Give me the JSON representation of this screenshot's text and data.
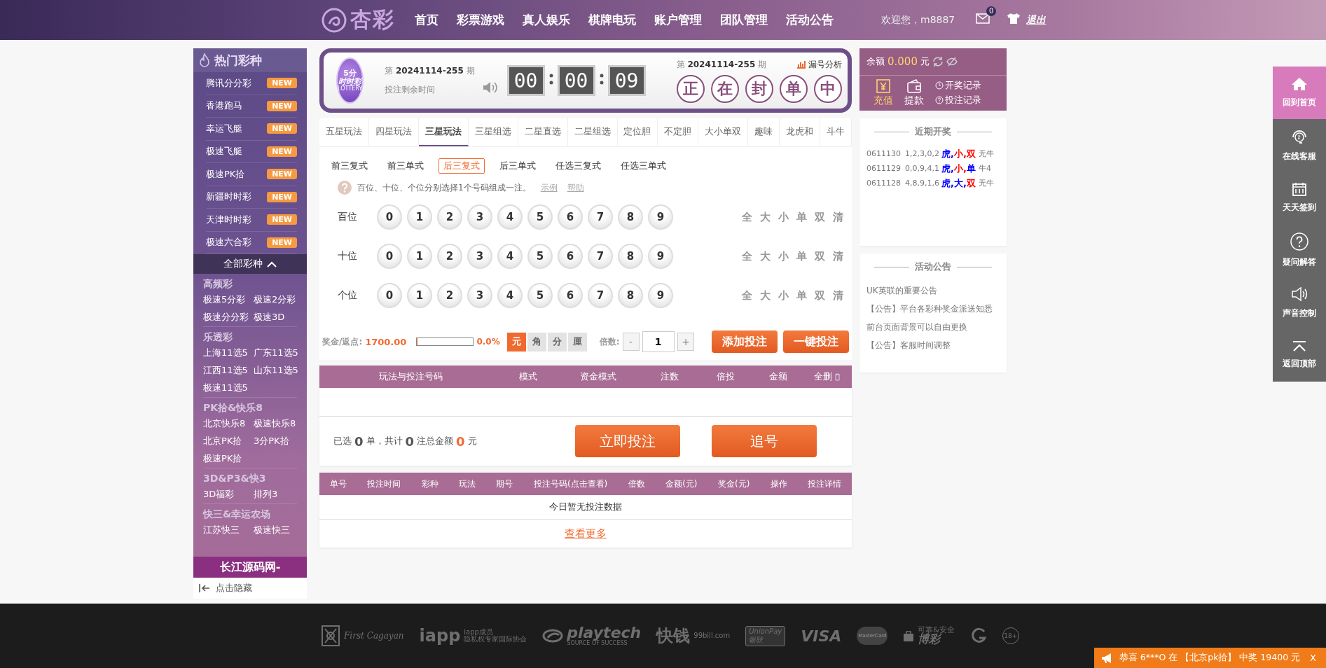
{
  "header": {
    "logo": "杏彩",
    "nav": [
      "首页",
      "彩票游戏",
      "真人娱乐",
      "棋牌电玩",
      "账户管理",
      "团队管理",
      "活动公告"
    ],
    "welcome": "欢迎您，m8887",
    "mail_count": "0",
    "logout": "退出"
  },
  "sidebar": {
    "title": "热门彩种",
    "hot": [
      {
        "name": "腾讯分分彩",
        "badge": "NEW"
      },
      {
        "name": "香港跑马",
        "badge": "NEW"
      },
      {
        "name": "幸运飞艇",
        "badge": "NEW"
      },
      {
        "name": "极速飞艇",
        "badge": "NEW"
      },
      {
        "name": "极速PK拾",
        "badge": "NEW"
      },
      {
        "name": "新疆时时彩",
        "badge": "NEW"
      },
      {
        "name": "天津时时彩",
        "badge": "NEW"
      },
      {
        "name": "极速六合彩",
        "badge": "NEW"
      }
    ],
    "all_toggle": "全部彩种",
    "expanded": true,
    "groups": [
      {
        "title": "高频彩",
        "items": [
          "极速5分彩",
          "极速2分彩",
          "极速分分彩",
          "极速3D"
        ]
      },
      {
        "title": "乐透彩",
        "items": [
          "上海11选5",
          "广东11选5",
          "江西11选5",
          "山东11选5",
          "极速11选5"
        ]
      },
      {
        "title": "PK拾&快乐8",
        "items": [
          "北京快乐8",
          "极速快乐8",
          "北京PK拾",
          "3分PK拾",
          "极速PK拾"
        ]
      },
      {
        "title": "3D&P3&快3",
        "items": [
          "3D福彩",
          "排列3"
        ]
      },
      {
        "title": "快三&幸运农场",
        "items": [
          "江苏快三",
          "极速快三"
        ]
      }
    ],
    "banner": "长江源码网-",
    "hide": "点击隐藏"
  },
  "draw_panel": {
    "badge_top": "5分",
    "badge_main": "时时彩",
    "badge_sub": "LOTTERY",
    "issue": "第 **20241114-255** 期",
    "countdown_label": "投注剩余时间",
    "countdown": [
      "00",
      "00",
      "09"
    ],
    "next_issue": "第 **20241114-255** 期",
    "analysis": "漏号分析",
    "status": [
      "正",
      "在",
      "封",
      "单",
      "中"
    ]
  },
  "play_tabs": [
    {
      "label": "五星玩法",
      "selected": false
    },
    {
      "label": "四星玩法",
      "selected": false
    },
    {
      "label": "三星玩法",
      "selected": true
    },
    {
      "label": "三星组选",
      "selected": false
    },
    {
      "label": "二星直选",
      "selected": false
    },
    {
      "label": "二星组选",
      "selected": false
    },
    {
      "label": "定位胆",
      "selected": false
    },
    {
      "label": "不定胆",
      "selected": false
    },
    {
      "label": "大小单双",
      "selected": false
    },
    {
      "label": "趣味",
      "selected": false
    },
    {
      "label": "龙虎和",
      "selected": false
    },
    {
      "label": "斗牛",
      "selected": false
    }
  ],
  "sub_tabs": [
    {
      "label": "前三复式",
      "selected": false
    },
    {
      "label": "前三单式",
      "selected": false
    },
    {
      "label": "后三复式",
      "selected": true
    },
    {
      "label": "后三单式",
      "selected": false
    },
    {
      "label": "任选三复式",
      "selected": false
    },
    {
      "label": "任选三单式",
      "selected": false
    }
  ],
  "hint": {
    "text": "百位、十位、个位分别选择1个号码组成一注。",
    "example": "示例",
    "help": "帮助"
  },
  "positions": [
    {
      "label": "百位",
      "balls": [
        {
          "label": "0",
          "selected": false
        },
        {
          "label": "1",
          "selected": false
        },
        {
          "label": "2",
          "selected": false
        },
        {
          "label": "3",
          "selected": false
        },
        {
          "label": "4",
          "selected": false
        },
        {
          "label": "5",
          "selected": false
        },
        {
          "label": "6",
          "selected": false
        },
        {
          "label": "7",
          "selected": false
        },
        {
          "label": "8",
          "selected": false
        },
        {
          "label": "9",
          "selected": false
        }
      ],
      "quick": [
        "全",
        "大",
        "小",
        "单",
        "双",
        "清"
      ]
    },
    {
      "label": "十位",
      "balls": [
        {
          "label": "0",
          "selected": false
        },
        {
          "label": "1",
          "selected": false
        },
        {
          "label": "2",
          "selected": false
        },
        {
          "label": "3",
          "selected": false
        },
        {
          "label": "4",
          "selected": false
        },
        {
          "label": "5",
          "selected": false
        },
        {
          "label": "6",
          "selected": false
        },
        {
          "label": "7",
          "selected": false
        },
        {
          "label": "8",
          "selected": false
        },
        {
          "label": "9",
          "selected": false
        }
      ],
      "quick": [
        "全",
        "大",
        "小",
        "单",
        "双",
        "清"
      ]
    },
    {
      "label": "个位",
      "balls": [
        {
          "label": "0",
          "selected": false
        },
        {
          "label": "1",
          "selected": false
        },
        {
          "label": "2",
          "selected": false
        },
        {
          "label": "3",
          "selected": false
        },
        {
          "label": "4",
          "selected": false
        },
        {
          "label": "5",
          "selected": false
        },
        {
          "label": "6",
          "selected": false
        },
        {
          "label": "7",
          "selected": false
        },
        {
          "label": "8",
          "selected": false
        },
        {
          "label": "9",
          "selected": false
        }
      ],
      "quick": [
        "全",
        "大",
        "小",
        "单",
        "双",
        "清"
      ]
    }
  ],
  "bet_bar": {
    "prize_label": "奖金/返点:",
    "prize": "1700.00",
    "rebate": {
      "level": 0,
      "reading": "0.0%"
    },
    "units": [
      {
        "label": "元",
        "selected": true
      },
      {
        "label": "角",
        "selected": false
      },
      {
        "label": "分",
        "selected": false
      },
      {
        "label": "厘",
        "selected": false
      }
    ],
    "multiple_label": "倍数:",
    "minus": "-",
    "multiple": "1",
    "plus": "+",
    "add": "添加投注",
    "quick_bet": "一键投注"
  },
  "cart": {
    "columns": [
      "玩法与投注号码",
      "模式",
      "资金模式",
      "注数",
      "倍投",
      "金额"
    ],
    "clear": "全删",
    "summary": {
      "selected_label": "已选",
      "orders": "0",
      "orders_unit": "单，共计",
      "bets": "0",
      "bets_unit": "注总金额",
      "amount": "0",
      "amount_unit": "元"
    },
    "buttons": [
      "立即投注",
      "追号"
    ]
  },
  "records": {
    "columns": [
      "单号",
      "投注时间",
      "彩种",
      "玩法",
      "期号",
      "投注号码(点击查看)",
      "倍数",
      "金额(元)",
      "奖金(元)",
      "操作",
      "投注详情"
    ],
    "empty": "今日暂无投注数据",
    "more": "查看更多"
  },
  "account": {
    "balance_label": "余额",
    "balance": "0.000",
    "currency": "元",
    "actions": [
      {
        "kind": "deposit",
        "label": "充值"
      },
      {
        "kind": "withdraw",
        "label": "提款"
      }
    ],
    "links": [
      {
        "kind": "clock",
        "label": "开奖记录"
      },
      {
        "kind": "question",
        "label": "投注记录"
      }
    ]
  },
  "recent_draws": {
    "title": "近期开奖",
    "rows": [
      {
        "issue": "0611130",
        "numbers": "1,2,3,0,2",
        "tags": [
          {
            "text": "虎,",
            "color": "#0000ff"
          },
          {
            "text": "小,",
            "color": "#ff0000"
          },
          {
            "text": "双",
            "color": "#ff0000"
          }
        ],
        "niu": "无牛"
      },
      {
        "issue": "0611129",
        "numbers": "0,0,9,4,1",
        "tags": [
          {
            "text": "虎,",
            "color": "#0000ff"
          },
          {
            "text": "小,",
            "color": "#ff0000"
          },
          {
            "text": "单",
            "color": "#0000ff"
          }
        ],
        "niu": "牛4"
      },
      {
        "issue": "0611128",
        "numbers": "4,8,9,1,6",
        "tags": [
          {
            "text": "虎,",
            "color": "#0000ff"
          },
          {
            "text": "大,",
            "color": "#0000ff"
          },
          {
            "text": "双",
            "color": "#ff0000"
          }
        ],
        "niu": "无牛"
      }
    ]
  },
  "notices": {
    "title": "活动公告",
    "items": [
      "UK英联的重要公告",
      "【公告】平台各彩种奖金派送知悉",
      "前台页面背景可以自由更换",
      "【公告】客服时间调整"
    ]
  },
  "float_bar": [
    {
      "kind": "home",
      "label": "回到首页",
      "selected": true
    },
    {
      "kind": "support",
      "label": "在线客服",
      "selected": false
    },
    {
      "kind": "checkin",
      "label": "天天签到",
      "selected": false
    },
    {
      "kind": "faq",
      "label": "疑问解答",
      "selected": false
    },
    {
      "kind": "sound",
      "label": "声音控制",
      "selected": false
    },
    {
      "kind": "top",
      "label": "返回顶部",
      "selected": false
    }
  ],
  "footer": {
    "logos": [
      {
        "kind": "emblem",
        "texts": [
          "First Cagayan"
        ]
      },
      {
        "kind": "stacked",
        "texts": [
          "iapp",
          "iapp成员",
          "隐私权专家国际协会"
        ]
      },
      {
        "kind": "swirl",
        "texts": [
          "playtech",
          "SOURCE OF SUCCESS"
        ]
      },
      {
        "kind": "stacked",
        "texts": [
          "快钱",
          "99bill.com"
        ]
      },
      {
        "kind": "card",
        "texts": [
          "UnionPay",
          "银联"
        ]
      },
      {
        "kind": "plain",
        "texts": [
          "VISA"
        ]
      },
      {
        "kind": "circles",
        "texts": [
          "MasterCard"
        ]
      },
      {
        "kind": "bag",
        "texts": [
          "可靠&安全",
          "博彩"
        ]
      },
      {
        "kind": "g"
      },
      {
        "kind": "age",
        "texts": [
          "18+"
        ]
      }
    ]
  },
  "ticker": {
    "text": "恭喜 6***O 在 【北京pk拾】 中奖 19400 元",
    "close": "X"
  }
}
